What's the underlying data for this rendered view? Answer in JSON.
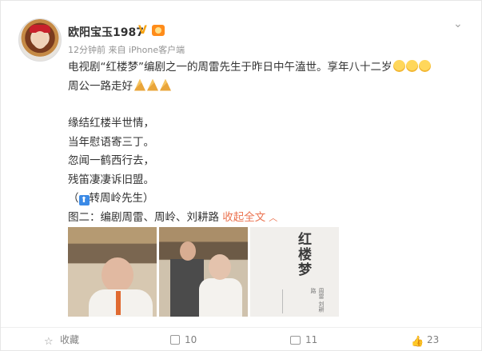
{
  "post": {
    "author": "欧阳宝玉1987",
    "meta": "12分钟前 来自 iPhone客户端",
    "lines": [
      "电视剧“红楼梦”编剧之一的周雷先生于昨日中午溘世。享年八十二岁",
      "周公一路走好",
      "缘结红楼半世情，",
      "当年慰语寄三丁。",
      "忽闻一鹤西行去，",
      "残笛凄凄诉旧盟。",
      "（",
      "转周岭先生）",
      "图二：编剧周雷、周岭、刘耕路",
      "收起全文"
    ],
    "book_title": "红楼梦",
    "book_sub": "周雷 刘耕路"
  },
  "actions": {
    "favorite_label": "收藏",
    "forward_count": "10",
    "comment_count": "11",
    "like_count": "23"
  },
  "icons": {
    "header": [
      "verified-v-icon",
      "level-badge-icon",
      "chevron-down-icon"
    ],
    "inline": [
      "crying-emoji-icon",
      "pray-emoji-icon",
      "up-arrow-icon"
    ],
    "actions": [
      "star-icon",
      "forward-icon",
      "comment-icon",
      "like-icon"
    ]
  },
  "colors": {
    "link": "#eb7350",
    "text": "#333333",
    "meta": "#939393"
  }
}
